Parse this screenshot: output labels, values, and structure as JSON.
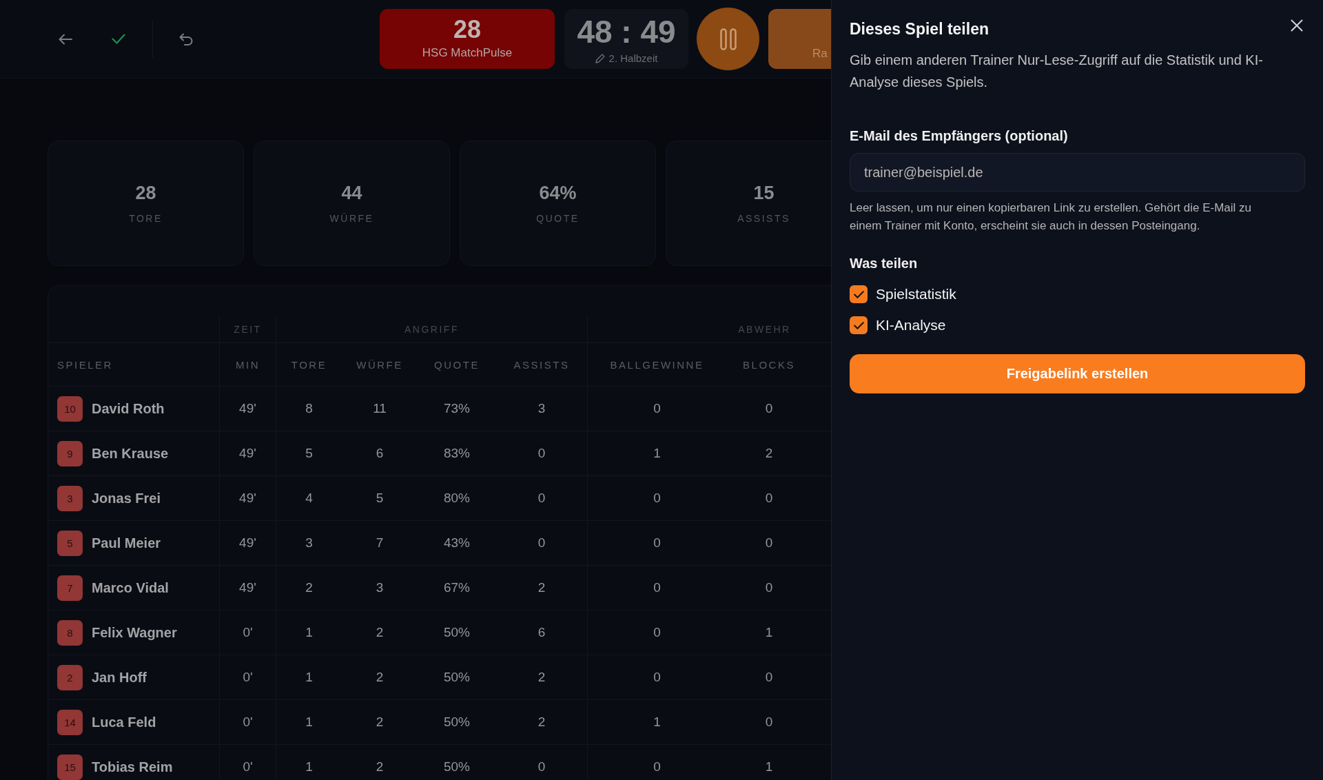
{
  "scoreboard": {
    "home": {
      "score": "28",
      "team": "HSG MatchPulse"
    },
    "clock": {
      "time": "48 : 49",
      "period": "2. Halbzeit"
    },
    "away": {
      "team": "Ra"
    }
  },
  "stats": [
    {
      "value": "28",
      "label": "TORE"
    },
    {
      "value": "44",
      "label": "WÜRFE"
    },
    {
      "value": "64%",
      "label": "QUOTE"
    },
    {
      "value": "15",
      "label": "ASSISTS"
    }
  ],
  "table": {
    "player_column": "SPIELER",
    "groups": [
      {
        "label": "ZEIT",
        "columns": [
          "MIN"
        ]
      },
      {
        "label": "ANGRIFF",
        "columns": [
          "TORE",
          "WÜRFE",
          "QUOTE",
          "ASSISTS"
        ]
      },
      {
        "label": "ABWEHR",
        "columns": [
          "BALLGEWINNE",
          "BLOCKS"
        ]
      }
    ],
    "rows": [
      {
        "number": "10",
        "name": "David Roth",
        "cells": [
          "49'",
          "8",
          "11",
          "73%",
          "3",
          "0",
          "0"
        ]
      },
      {
        "number": "9",
        "name": "Ben Krause",
        "cells": [
          "49'",
          "5",
          "6",
          "83%",
          "0",
          "1",
          "2"
        ]
      },
      {
        "number": "3",
        "name": "Jonas Frei",
        "cells": [
          "49'",
          "4",
          "5",
          "80%",
          "0",
          "0",
          "0"
        ]
      },
      {
        "number": "5",
        "name": "Paul Meier",
        "cells": [
          "49'",
          "3",
          "7",
          "43%",
          "0",
          "0",
          "0"
        ]
      },
      {
        "number": "7",
        "name": "Marco Vidal",
        "cells": [
          "49'",
          "2",
          "3",
          "67%",
          "2",
          "0",
          "0"
        ]
      },
      {
        "number": "8",
        "name": "Felix Wagner",
        "cells": [
          "0'",
          "1",
          "2",
          "50%",
          "6",
          "0",
          "1"
        ]
      },
      {
        "number": "2",
        "name": "Jan Hoff",
        "cells": [
          "0'",
          "1",
          "2",
          "50%",
          "2",
          "0",
          "0"
        ]
      },
      {
        "number": "14",
        "name": "Luca Feld",
        "cells": [
          "0'",
          "1",
          "2",
          "50%",
          "2",
          "1",
          "0"
        ]
      },
      {
        "number": "15",
        "name": "Tobias Reim",
        "cells": [
          "0'",
          "1",
          "2",
          "50%",
          "0",
          "0",
          "1"
        ]
      }
    ]
  },
  "share_panel": {
    "title": "Dieses Spiel teilen",
    "description": "Gib einem anderen Trainer Nur-Lese-Zugriff auf die Statistik und KI-Analyse dieses Spiels.",
    "email": {
      "label": "E-Mail des Empfängers (optional)",
      "placeholder": "trainer@beispiel.de",
      "hint": "Leer lassen, um nur einen kopierbaren Link zu erstellen. Gehört die E-Mail zu einem Trainer mit Konto, erscheint sie auch in dessen Posteingang."
    },
    "section_title": "Was teilen",
    "options": [
      {
        "label": "Spielstatistik",
        "checked": true
      },
      {
        "label": "KI-Analyse",
        "checked": true
      }
    ],
    "submit": "Freigabelink erstellen"
  }
}
